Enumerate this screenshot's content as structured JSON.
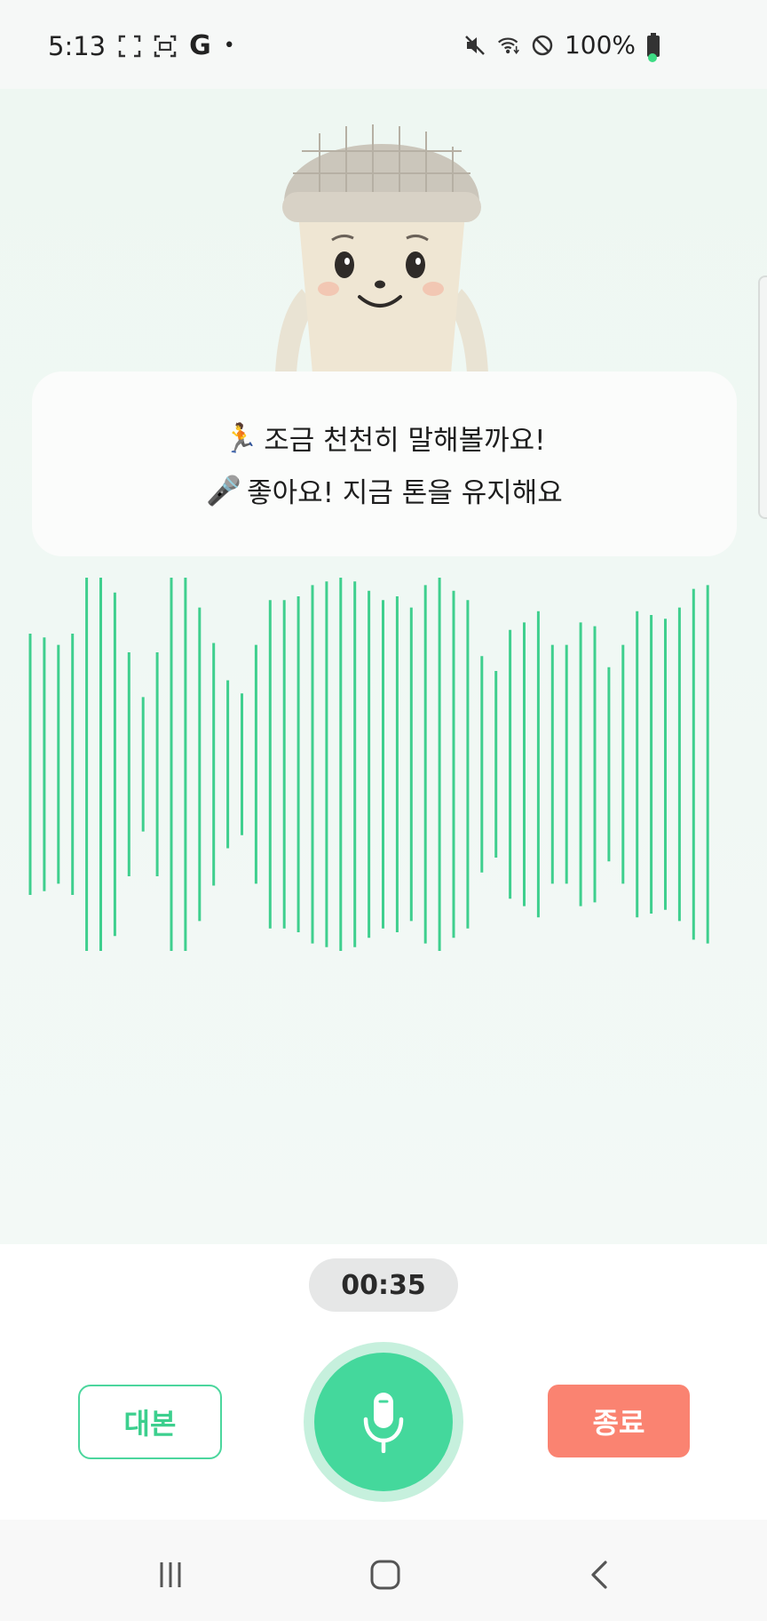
{
  "status_bar": {
    "time": "5:13",
    "g_label": "G",
    "dot": "•",
    "battery": "100%",
    "icons": [
      "screenshot-icon",
      "screen-record-icon",
      "google-icon",
      "mute-icon",
      "wifi-icon",
      "do-not-disturb-icon",
      "battery-icon"
    ]
  },
  "feedback": {
    "line1_emoji": "🏃",
    "line1_text": "조금 천천히 말해볼까요!",
    "line2_emoji": "🎤",
    "line2_text": "좋아요! 지금 톤을 유지해요"
  },
  "waveform": {
    "color": "#3fcf8e",
    "levels": [
      0.7,
      0.68,
      0.64,
      0.7,
      1.0,
      1.0,
      0.92,
      0.6,
      0.36,
      0.6,
      1.0,
      1.0,
      0.84,
      0.65,
      0.45,
      0.38,
      0.64,
      0.88,
      0.88,
      0.9,
      0.96,
      0.98,
      1.0,
      0.98,
      0.93,
      0.88,
      0.9,
      0.84,
      0.96,
      1.0,
      0.93,
      0.88,
      0.58,
      0.5,
      0.72,
      0.76,
      0.82,
      0.64,
      0.64,
      0.76,
      0.74,
      0.52,
      0.64,
      0.82,
      0.8,
      0.78,
      0.84,
      0.94,
      0.96
    ]
  },
  "controls": {
    "timer": "00:35",
    "script_label": "대본",
    "end_label": "종료",
    "accent_color": "#44d89c",
    "end_color": "#fa8371"
  },
  "nav": [
    "recent-apps-icon",
    "home-icon",
    "back-icon"
  ]
}
